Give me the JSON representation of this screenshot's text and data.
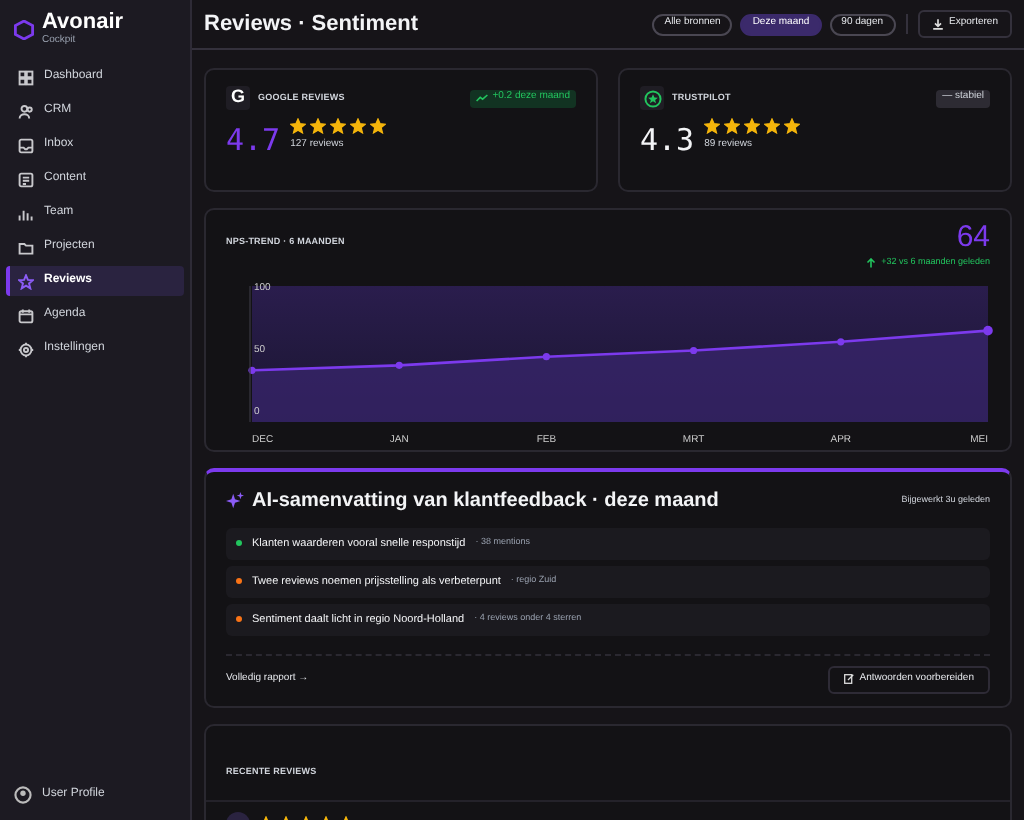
{
  "brand": {
    "name": "Avonair",
    "subtitle": "Cockpit"
  },
  "sidebar": {
    "items": [
      {
        "label": "Dashboard",
        "selected": false
      },
      {
        "label": "CRM",
        "selected": false
      },
      {
        "label": "Inbox",
        "selected": false
      },
      {
        "label": "Content",
        "selected": false
      },
      {
        "label": "Team",
        "selected": false
      },
      {
        "label": "Projecten",
        "selected": false
      },
      {
        "label": "Reviews",
        "selected": true
      },
      {
        "label": "Agenda",
        "selected": false
      },
      {
        "label": "Instellingen",
        "selected": false
      }
    ],
    "user": "User Profile"
  },
  "header": {
    "title": "Reviews · Sentiment",
    "filters": [
      {
        "label": "Alle bronnen",
        "selected": false
      },
      {
        "label": "Deze maand",
        "selected": true
      },
      {
        "label": "90 dagen",
        "selected": false
      }
    ],
    "export": "Exporteren"
  },
  "sources": [
    {
      "kind": "google",
      "logo": "G",
      "name": "GOOGLE REVIEWS",
      "badge": "+0.2 deze maand",
      "score": "4.7",
      "stars": 5,
      "count": "127 reviews"
    },
    {
      "kind": "trustpilot",
      "name": "TRUSTPILOT",
      "badge": "— stabiel",
      "score": "4.3",
      "stars": 5,
      "count": "89 reviews"
    }
  ],
  "nps": {
    "title": "NPS-TREND · 6 MAANDEN",
    "value": "64",
    "delta": "+32 vs 6 maanden geleden",
    "chart_data": {
      "type": "area",
      "categories": [
        "DEC",
        "JAN",
        "FEB",
        "MRT",
        "APR",
        "MEI"
      ],
      "series": [
        {
          "color": "#7c3aed",
          "values": [
            32,
            36,
            43,
            48,
            55,
            64
          ]
        }
      ],
      "ylim": [
        0,
        100
      ],
      "yticks": [
        0,
        50,
        100
      ]
    }
  },
  "summary": {
    "title": "AI-samenvatting van klantfeedback · deze maand",
    "updated": "Bijgewerkt 3u geleden",
    "items": [
      {
        "text": "Klanten waarderen vooral snelle responstijd",
        "note": "· 38 mentions",
        "color": "#22c55e"
      },
      {
        "text": "Twee reviews noemen prijsstelling als verbeterpunt",
        "note": "· regio Zuid",
        "color": "#f97316"
      },
      {
        "text": "Sentiment daalt licht in regio Noord-Holland",
        "note": "· 4 reviews onder 4 sterren",
        "color": "#f97316"
      }
    ],
    "link": "Volledig rapport →",
    "action": "Antwoorden voorbereiden"
  },
  "recent": {
    "title": "RECENTE REVIEWS",
    "reviews": [
      {
        "stars": 5
      }
    ]
  }
}
